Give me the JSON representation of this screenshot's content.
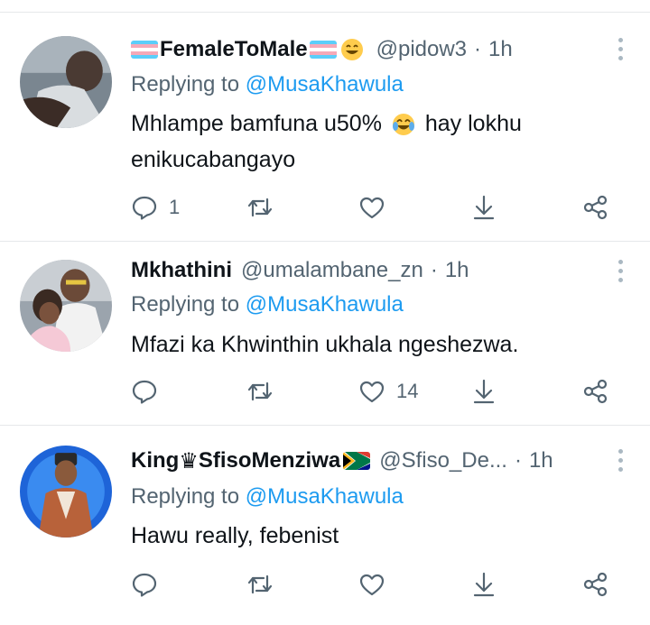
{
  "tweets": [
    {
      "name": "FemaleToMale",
      "handle": "@pidow3",
      "time": "1h",
      "reply_prefix": "Replying to ",
      "reply_to": "@MusaKhawula",
      "text_a": "Mhlampe bamfuna u50%",
      "text_b": "hay lokhu enikucabangayo",
      "reply_count": "1",
      "retweet_count": "",
      "like_count": ""
    },
    {
      "name": "Mkhathini",
      "handle": "@umalambane_zn",
      "time": "1h",
      "reply_prefix": "Replying to ",
      "reply_to": "@MusaKhawula",
      "text": "Mfazi ka Khwinthin ukhala ngeshezwa.",
      "reply_count": "",
      "retweet_count": "",
      "like_count": "14"
    },
    {
      "name_a": "King",
      "crown": "♛",
      "name_b": "SfisoMenziwa",
      "handle": "@Sfiso_De...",
      "time": "1h",
      "reply_prefix": "Replying to ",
      "reply_to": "@MusaKhawula",
      "text": "Hawu really, febenist",
      "reply_count": "",
      "retweet_count": "",
      "like_count": ""
    }
  ],
  "colors": {
    "link": "#1d9bf0",
    "muted": "#536471",
    "text": "#0f1419",
    "divider": "#e6e8ea"
  },
  "icons": [
    "reply-icon",
    "retweet-icon",
    "like-icon",
    "download-icon",
    "share-icon",
    "more-icon",
    "trans-flag-icon",
    "south-africa-flag-icon",
    "grinning-emoji-icon",
    "tears-of-joy-emoji-icon"
  ]
}
